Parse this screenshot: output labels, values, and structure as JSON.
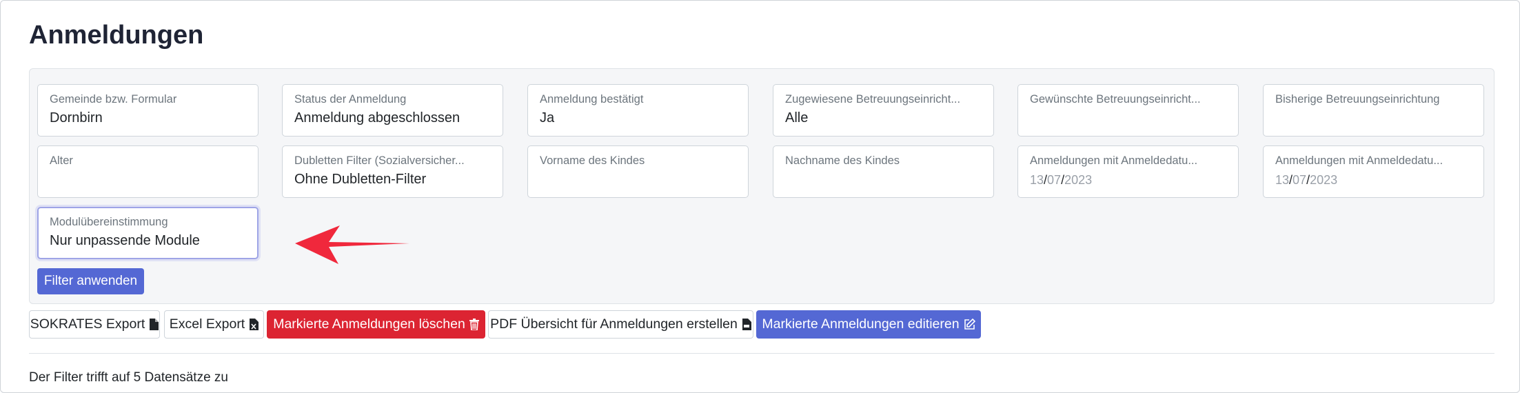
{
  "page": {
    "title": "Anmeldungen"
  },
  "filters": [
    {
      "label": "Gemeinde bzw. Formular",
      "value": "Dornbirn"
    },
    {
      "label": "Status der Anmeldung",
      "value": "Anmeldung abgeschlossen"
    },
    {
      "label": "Anmeldung bestätigt",
      "value": "Ja"
    },
    {
      "label": "Zugewiesene Betreuungseinricht...",
      "value": "Alle"
    },
    {
      "label": "Gewünschte Betreuungseinricht...",
      "value": ""
    },
    {
      "label": "Bisherige Betreuungseinrichtung",
      "value": ""
    },
    {
      "label": "Alter",
      "value": ""
    },
    {
      "label": "Dubletten Filter (Sozialversicher...",
      "value": "Ohne Dubletten-Filter"
    },
    {
      "label": "Vorname des Kindes",
      "value": ""
    },
    {
      "label": "Nachname des Kindes",
      "value": ""
    },
    {
      "label": "Anmeldungen mit Anmeldedatu...",
      "date": {
        "day": "13",
        "month": "07",
        "year": "2023"
      }
    },
    {
      "label": "Anmeldungen mit Anmeldedatu...",
      "date": {
        "day": "13",
        "month": "07",
        "year": "2023"
      }
    },
    {
      "label": "Modulübereinstimmung",
      "value": "Nur unpassende Module"
    }
  ],
  "apply_button": "Filter anwenden",
  "actions": [
    {
      "label": "SOKRATES Export",
      "icon": "file-icon"
    },
    {
      "label": "Excel Export",
      "icon": "excel-file-icon"
    },
    {
      "label": "Markierte Anmeldungen löschen",
      "icon": "trash-icon"
    },
    {
      "label": "PDF Übersicht für Anmeldungen erstellen",
      "icon": "pdf-file-icon"
    },
    {
      "label": "Markierte Anmeldungen editieren",
      "icon": "edit-icon"
    }
  ],
  "status_text": "Der Filter trifft auf 5 Datensätze zu",
  "date_separator": "/",
  "colors": {
    "primary": "#5468d4",
    "danger": "#dc2432",
    "arrow": "#f0283c"
  }
}
